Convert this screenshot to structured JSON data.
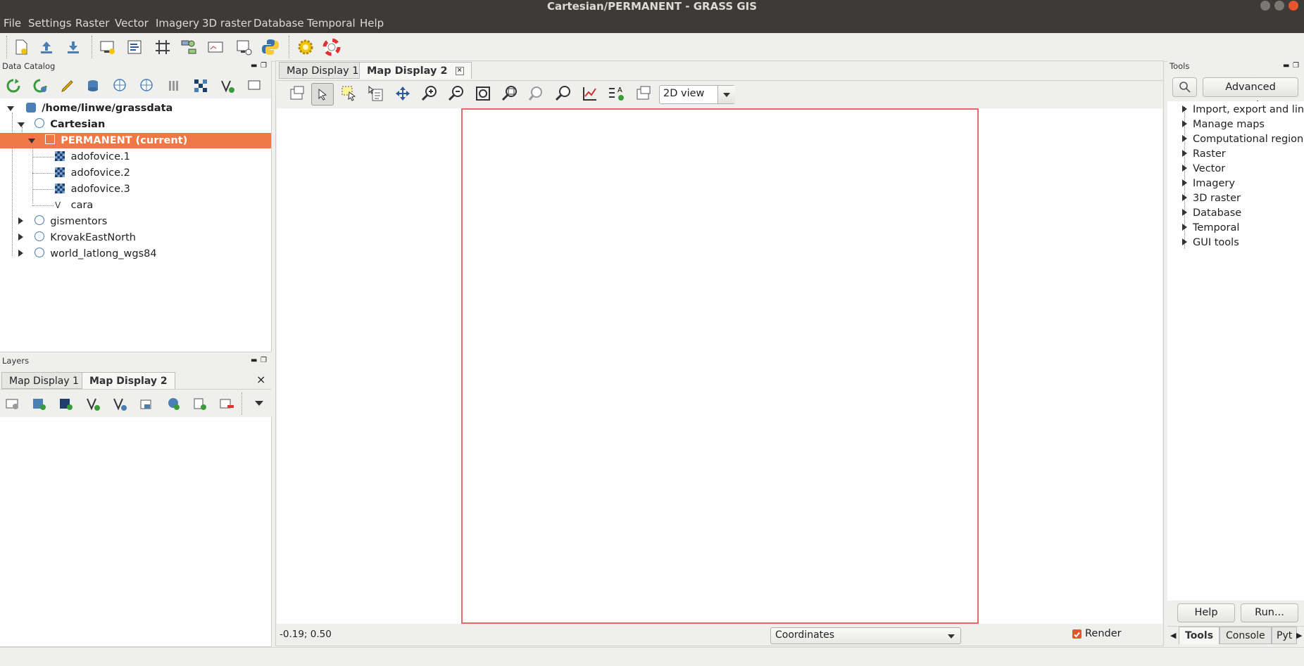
{
  "window": {
    "title": "Cartesian/PERMANENT - GRASS GIS"
  },
  "menu": [
    "File",
    "Settings",
    "Raster",
    "Vector",
    "Imagery",
    "3D raster",
    "Database",
    "Temporal",
    "Help"
  ],
  "main_toolbar": {
    "icons": [
      "new-workspace-icon",
      "open-workspace-icon",
      "save-workspace-icon",
      "new-map-display-icon",
      "cartographic-composer-icon",
      "georectifier-icon",
      "graphical-modeler-icon",
      "map-3d-icon",
      "map-composer-icon",
      "python-shell-icon",
      "settings-icon",
      "help-icon"
    ]
  },
  "data_catalog": {
    "title": "Data Catalog",
    "root": "/home/linwe/grassdata",
    "location": "Cartesian",
    "mapset": "PERMANENT  (current)",
    "layers": [
      "adofovice.1",
      "adofovice.2",
      "adofovice.3",
      "cara"
    ],
    "other_locations": [
      "gismentors",
      "KrovakEastNorth",
      "world_latlong_wgs84"
    ]
  },
  "layers_panel": {
    "title": "Layers",
    "tabs": [
      "Map Display 1",
      "Map Display 2"
    ],
    "close": "×"
  },
  "map": {
    "tabs": [
      "Map Display 1",
      "Map Display 2"
    ],
    "view_mode": "2D view",
    "coords": "-0.19; 0.50",
    "status_mode": "Coordinates",
    "render_label": "Render",
    "render_checked": true,
    "region_color": "#e8676a"
  },
  "tools_panel": {
    "title": "Tools",
    "advanced_search": "Advanced search...",
    "items": [
      "Import, export and lin",
      "Manage maps",
      "Computational region",
      "Raster",
      "Vector",
      "Imagery",
      "3D raster",
      "Database",
      "Temporal",
      "GUI tools"
    ],
    "help_button": "Help",
    "run_button": "Run...",
    "bottom_tabs": [
      "Tools",
      "Console",
      "Pyt"
    ]
  },
  "colors": {
    "selection": "#f07746",
    "titlebar": "#3c3b37"
  }
}
